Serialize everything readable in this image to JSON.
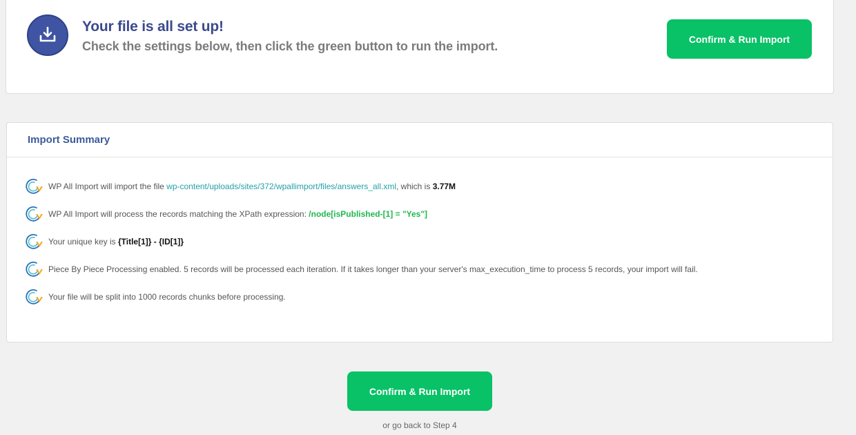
{
  "header": {
    "title": "Your file is all set up!",
    "subtitle": "Check the settings below, then click the green button to run the import.",
    "confirm_label": "Confirm & Run Import",
    "icon": "download-tray-icon"
  },
  "summary": {
    "title": "Import Summary",
    "item_icon": "wp-all-import-logo-icon",
    "items": [
      {
        "prefix": "WP All Import will import the file ",
        "file_link": "wp-content/uploads/sites/372/wpallimport/files/answers_all.xml",
        "middle": ", which is ",
        "size": "3.77M"
      },
      {
        "prefix": "WP All Import will process the records matching the XPath expression: ",
        "xpath": "/node[isPublished-[1] = \"Yes\"]"
      },
      {
        "prefix": "Your unique key is ",
        "key": "{Title[1]} - {ID[1]}"
      },
      {
        "text": "Piece By Piece Processing enabled. 5 records will be processed each iteration. If it takes longer than your server's max_execution_time to process 5 records, your import will fail."
      },
      {
        "text": "Your file will be split into 1000 records chunks before processing."
      }
    ]
  },
  "footer": {
    "confirm_label": "Confirm & Run Import",
    "back_link": "or go back to Step 4"
  },
  "colors": {
    "accent_green": "#09c166",
    "heading_blue": "#3b4a8c",
    "link_teal": "#23a0a8",
    "xpath_green": "#1fb84f"
  }
}
